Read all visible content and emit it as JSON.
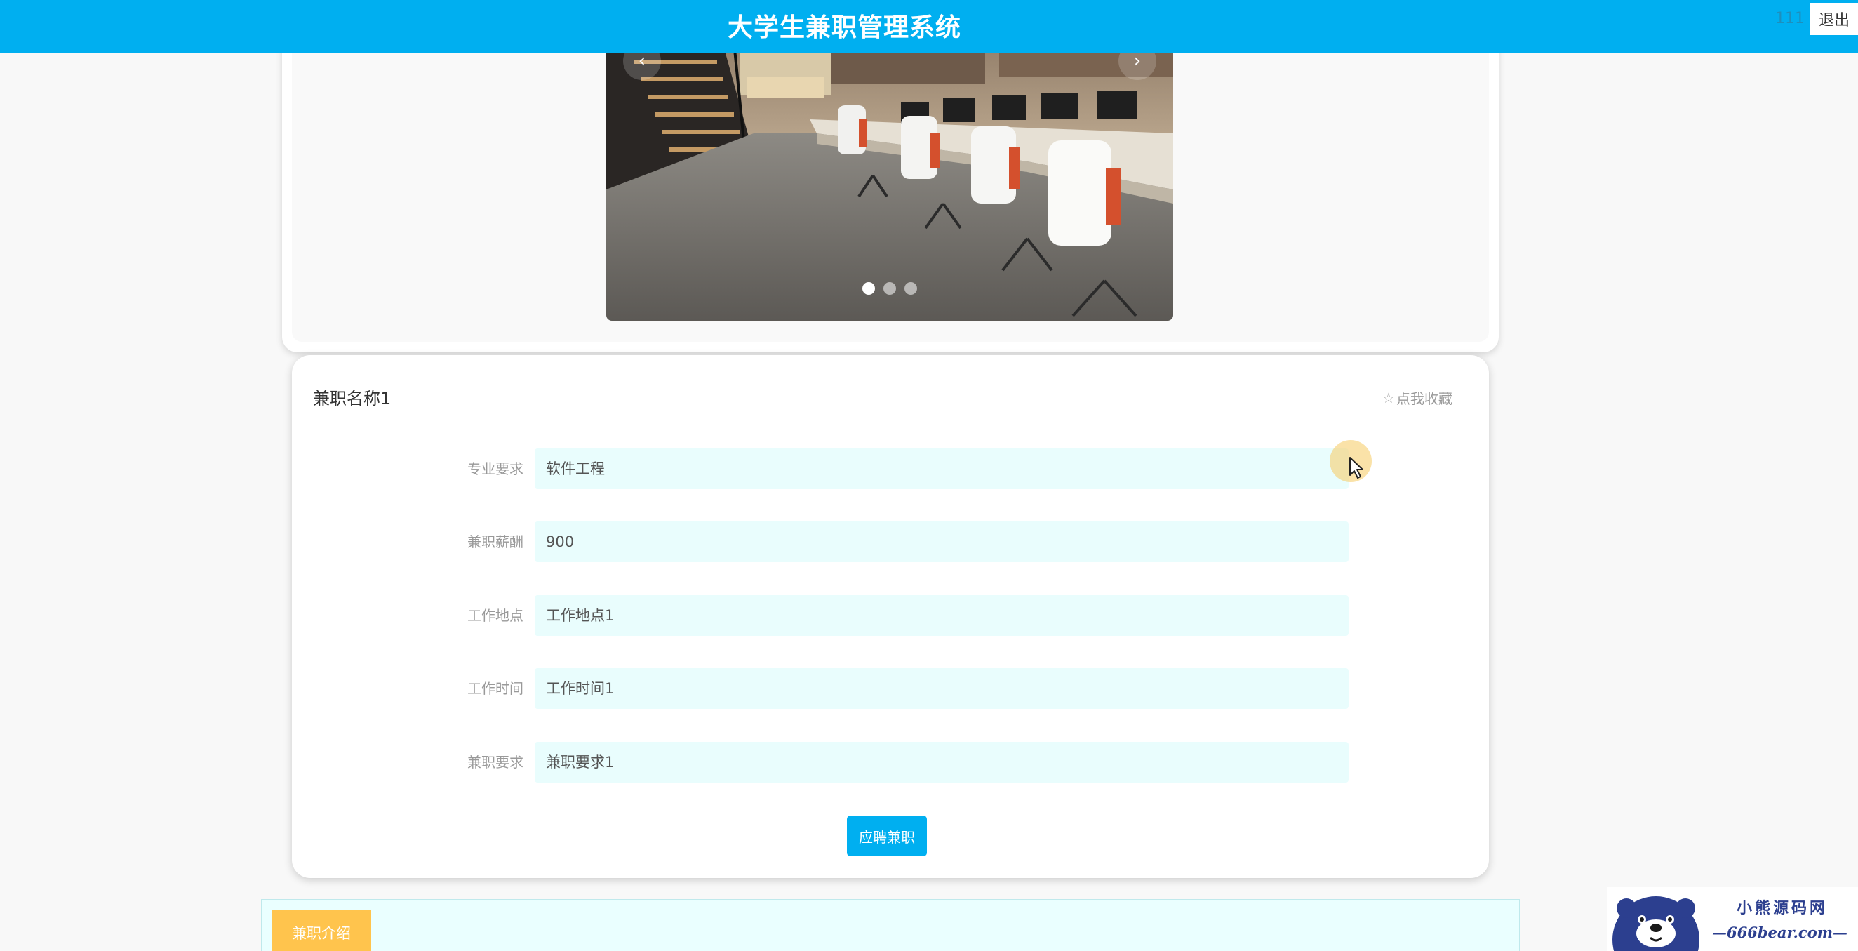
{
  "header": {
    "site_title": "大学生兼职管理系统",
    "user_name": "111",
    "logout_label": "退出"
  },
  "carousel": {
    "prev_label": "‹",
    "next_label": "›",
    "slide_count": 3,
    "active_slide": 1
  },
  "job": {
    "name": "兼职名称1",
    "favorite_label": "点我收藏",
    "favorite_icon": "star-outline-icon",
    "fields": [
      {
        "label": "专业要求",
        "value": "软件工程"
      },
      {
        "label": "兼职薪酬",
        "value": "900"
      },
      {
        "label": "工作地点",
        "value": "工作地点1"
      },
      {
        "label": "工作时间",
        "value": "工作时间1"
      },
      {
        "label": "兼职要求",
        "value": "兼职要求1"
      }
    ],
    "apply_label": "应聘兼职"
  },
  "intro": {
    "tab_label": "兼职介绍"
  },
  "watermark": {
    "line1": "小熊源码网",
    "line2": "—666bear.com—"
  },
  "colors": {
    "primary": "#00aff0",
    "input_bg": "#e9fdfd",
    "intro_tab": "#ffc44d",
    "page_bg": "#f8f8f8"
  }
}
